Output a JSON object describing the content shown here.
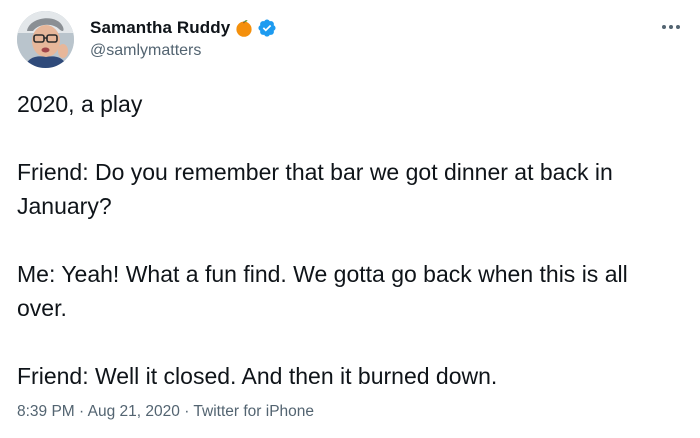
{
  "author": {
    "display_name": "Samantha Ruddy",
    "handle": "@samlymatters",
    "emoji": "orange-emoji",
    "verified": true,
    "accent_color": "#1d9bf0"
  },
  "tweet": {
    "lines": [
      "2020, a play",
      "",
      "Friend: Do you remember that bar we got dinner at back in January?",
      "",
      "Me: Yeah! What a fun find. We gotta go back when this is all over.",
      "",
      "Friend: Well it closed. And then it burned down."
    ]
  },
  "meta": {
    "time": "8:39 PM",
    "separator": "·",
    "date": "Aug 21, 2020",
    "source": "Twitter for iPhone"
  },
  "icons": {
    "more": "more-options-icon",
    "verified": "verified-badge-icon"
  }
}
